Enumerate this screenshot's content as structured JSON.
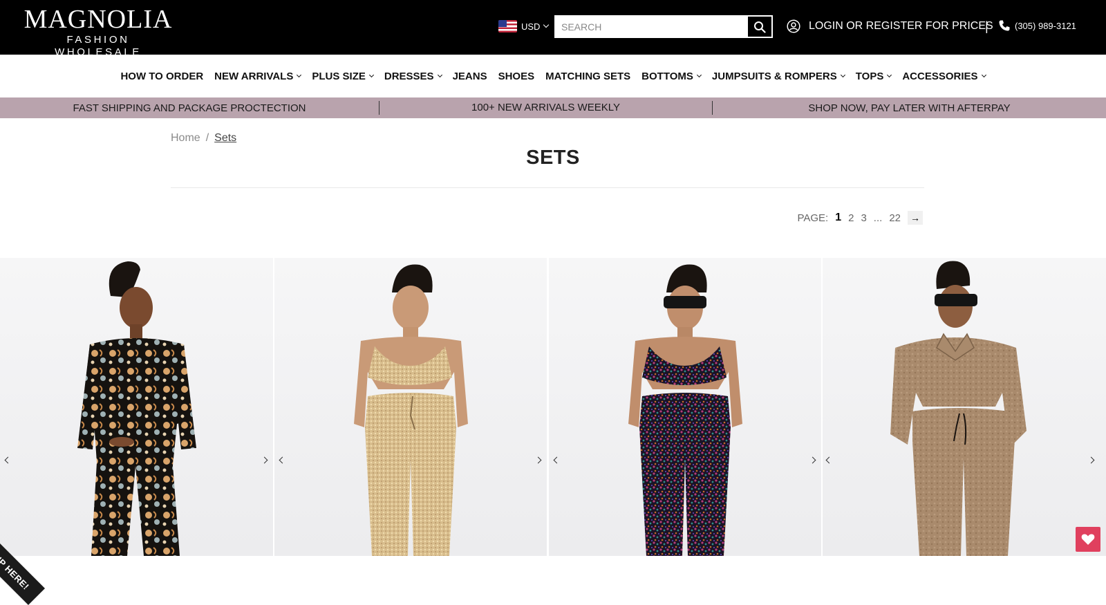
{
  "header": {
    "logo_main": "MAGNOLIA",
    "logo_sub": "FASHION WHOLESALE",
    "currency": "USD",
    "search_placeholder": "SEARCH",
    "account_label": "LOGIN OR REGISTER FOR PRICES",
    "separator": "|",
    "phone": "(305) 989-3121"
  },
  "nav": {
    "items": [
      {
        "label": "HOW TO ORDER",
        "dropdown": false
      },
      {
        "label": "NEW ARRIVALS",
        "dropdown": true
      },
      {
        "label": "PLUS SIZE",
        "dropdown": true
      },
      {
        "label": "DRESSES",
        "dropdown": true
      },
      {
        "label": "JEANS",
        "dropdown": false
      },
      {
        "label": "SHOES",
        "dropdown": false
      },
      {
        "label": "MATCHING SETS",
        "dropdown": false
      },
      {
        "label": "BOTTOMS",
        "dropdown": true
      },
      {
        "label": "JUMPSUITS & ROMPERS",
        "dropdown": true
      },
      {
        "label": "TOPS",
        "dropdown": true
      },
      {
        "label": "ACCESSORIES",
        "dropdown": true
      }
    ]
  },
  "promo": {
    "items": [
      "FAST SHIPPING AND PACKAGE PROCTECTION",
      "100+ NEW ARRIVALS WEEKLY",
      "SHOP NOW, PAY LATER WITH AFTERPAY"
    ],
    "bg_color": "#b9a3ad"
  },
  "breadcrumb": {
    "home": "Home",
    "separator": "/",
    "current": "Sets"
  },
  "page": {
    "title": "SETS"
  },
  "pagination": {
    "label": "PAGE:",
    "pages": [
      "1",
      "2",
      "3",
      "...",
      "22"
    ],
    "current": "1",
    "next_symbol": "→"
  },
  "products": [
    {
      "outfit": "black paisley print jacket and pants set"
    },
    {
      "outfit": "gold sequin bralette and joggers set"
    },
    {
      "outfit": "iridescent sequin bralette and joggers set"
    },
    {
      "outfit": "tan fleece pullover and joggers set"
    }
  ],
  "overlays": {
    "signup_label": "SIGN UP HERE!",
    "wishlist_color": "#e0405e"
  }
}
